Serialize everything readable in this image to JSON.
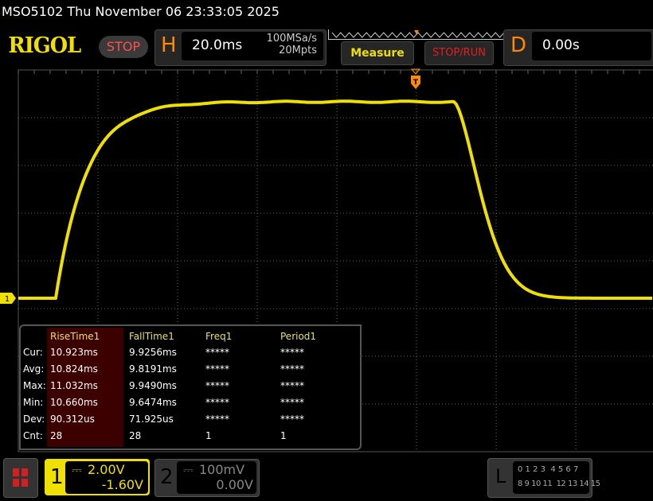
{
  "status_bar": {
    "title": "MSO5102  Thu November 06 23:33:05 2025"
  },
  "brand": {
    "logo": "RIGOL",
    "run_state": "STOP"
  },
  "horizontal": {
    "letter": "H",
    "timebase": "20.0ms",
    "sample_rate": "100MSa/s",
    "memory_depth": "20Mpts"
  },
  "buttons": {
    "measure": "Measure",
    "stop_run": "STOP/RUN"
  },
  "delay": {
    "letter": "D",
    "value": "0.00s"
  },
  "trigger": {
    "marker": "T"
  },
  "channel_marker": "1",
  "colors": {
    "ch1": "#f0e000",
    "accent": "#ff8a00",
    "stop": "#e02020"
  },
  "measurements": {
    "headers": [
      "RiseTime1",
      "FallTime1",
      "Freq1",
      "Period1"
    ],
    "rows": [
      {
        "label": "Cur:",
        "values": [
          "10.923ms",
          "9.9256ms",
          "*****",
          "*****"
        ]
      },
      {
        "label": "Avg:",
        "values": [
          "10.824ms",
          "9.8191ms",
          "*****",
          "*****"
        ]
      },
      {
        "label": "Max:",
        "values": [
          "11.032ms",
          "9.9490ms",
          "*****",
          "*****"
        ]
      },
      {
        "label": "Min:",
        "values": [
          "10.660ms",
          "9.6474ms",
          "*****",
          "*****"
        ]
      },
      {
        "label": "Dev:",
        "values": [
          "90.312us",
          "71.925us",
          "*****",
          "*****"
        ]
      },
      {
        "label": "Cnt:",
        "values": [
          "28",
          "28",
          "1",
          "1"
        ]
      }
    ]
  },
  "channels": [
    {
      "num": "1",
      "scale": "2.00V",
      "offset": "-1.60V",
      "active": true
    },
    {
      "num": "2",
      "scale": "100mV",
      "offset": "0.00V",
      "active": false
    }
  ],
  "logic": {
    "letter": "L",
    "row1": "0 1 2 3  4 5 6 7",
    "row2": "8 9 10 11  12 13 14 15"
  }
}
